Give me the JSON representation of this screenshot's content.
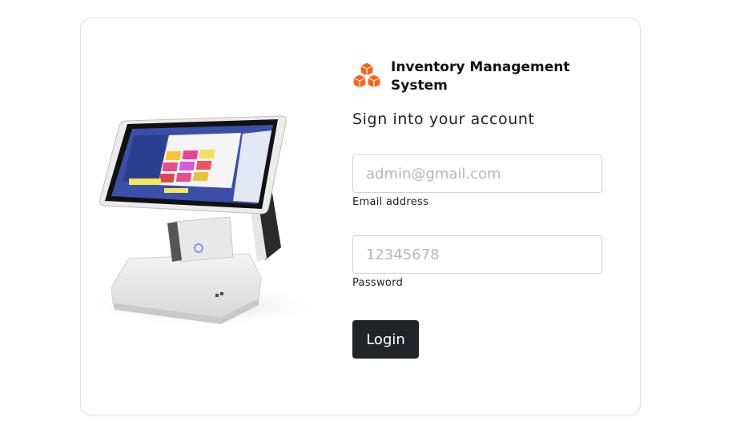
{
  "brand": {
    "title": "Inventory Management System",
    "icon": "boxes-icon",
    "accent_color": "#ff6219"
  },
  "form": {
    "heading": "Sign into your account",
    "email": {
      "placeholder": "admin@gmail.com",
      "value": "",
      "label": "Email address"
    },
    "password": {
      "placeholder": "12345678",
      "value": "",
      "label": "Password"
    },
    "submit_label": "Login",
    "button_color": "#212529"
  },
  "media": {
    "illustration": "pos-terminal-image"
  }
}
